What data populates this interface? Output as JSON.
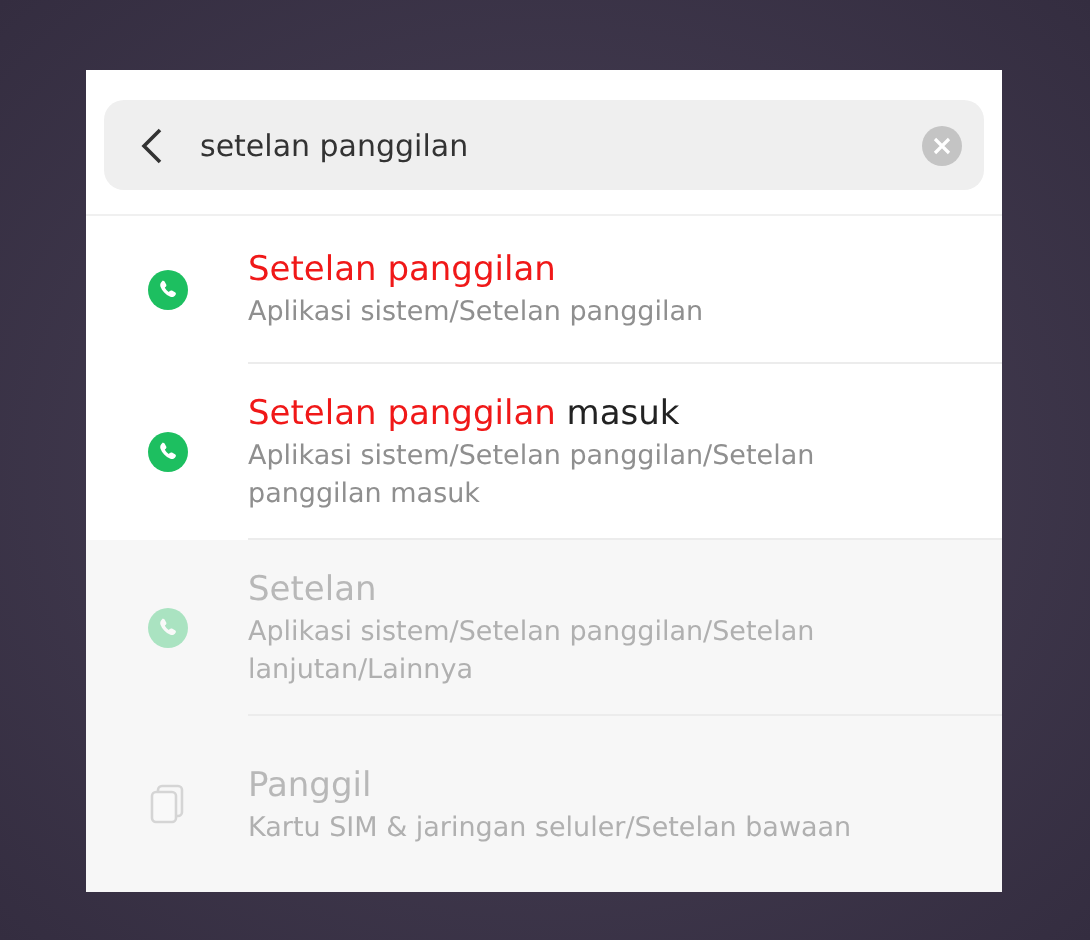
{
  "search": {
    "value": "setelan panggilan"
  },
  "results": [
    {
      "kind": "phone",
      "dimmed": false,
      "title": [
        {
          "text": "Setelan panggilan",
          "highlighted": true
        }
      ],
      "path": "Aplikasi sistem/Setelan panggilan"
    },
    {
      "kind": "phone",
      "dimmed": false,
      "title": [
        {
          "text": "Setelan panggilan",
          "highlighted": true
        },
        {
          "text": " masuk",
          "highlighted": false
        }
      ],
      "path": "Aplikasi sistem/Setelan panggilan/Setelan panggilan masuk"
    },
    {
      "kind": "phone",
      "dimmed": true,
      "title": [
        {
          "text": "Setelan",
          "highlighted": false
        }
      ],
      "path": "Aplikasi sistem/Setelan panggilan/Setelan lanjutan/Lainnya"
    },
    {
      "kind": "sim",
      "dimmed": true,
      "title": [
        {
          "text": "Panggil",
          "highlighted": false
        }
      ],
      "path": "Kartu SIM & jaringan seluler/Setelan bawaan"
    }
  ]
}
